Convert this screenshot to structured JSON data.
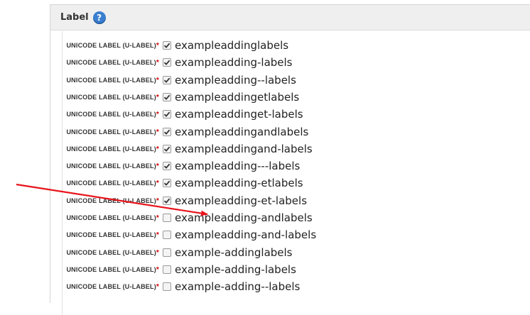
{
  "panel": {
    "title": "Label",
    "help_glyph": "?"
  },
  "field_label": "UNICODE LABEL (U-LABEL)",
  "required_mark": "*",
  "rows": [
    {
      "value": "exampleaddinglabels",
      "checked": true
    },
    {
      "value": "exampleadding-labels",
      "checked": true
    },
    {
      "value": "exampleadding--labels",
      "checked": true
    },
    {
      "value": "exampleaddingetlabels",
      "checked": true
    },
    {
      "value": "exampleaddinget-labels",
      "checked": true
    },
    {
      "value": "exampleaddingandlabels",
      "checked": true
    },
    {
      "value": "exampleaddingand-labels",
      "checked": true
    },
    {
      "value": "exampleadding---labels",
      "checked": true
    },
    {
      "value": "exampleadding-etlabels",
      "checked": true
    },
    {
      "value": "exampleadding-et-labels",
      "checked": true
    },
    {
      "value": "exampleadding-andlabels",
      "checked": false
    },
    {
      "value": "exampleadding-and-labels",
      "checked": false
    },
    {
      "value": "example-addinglabels",
      "checked": false
    },
    {
      "value": "example-adding-labels",
      "checked": false
    },
    {
      "value": "example-adding--labels",
      "checked": false
    }
  ],
  "colors": {
    "arrow": "#e8141c",
    "required": "#d00000",
    "help_icon": "#3a7fd0"
  }
}
